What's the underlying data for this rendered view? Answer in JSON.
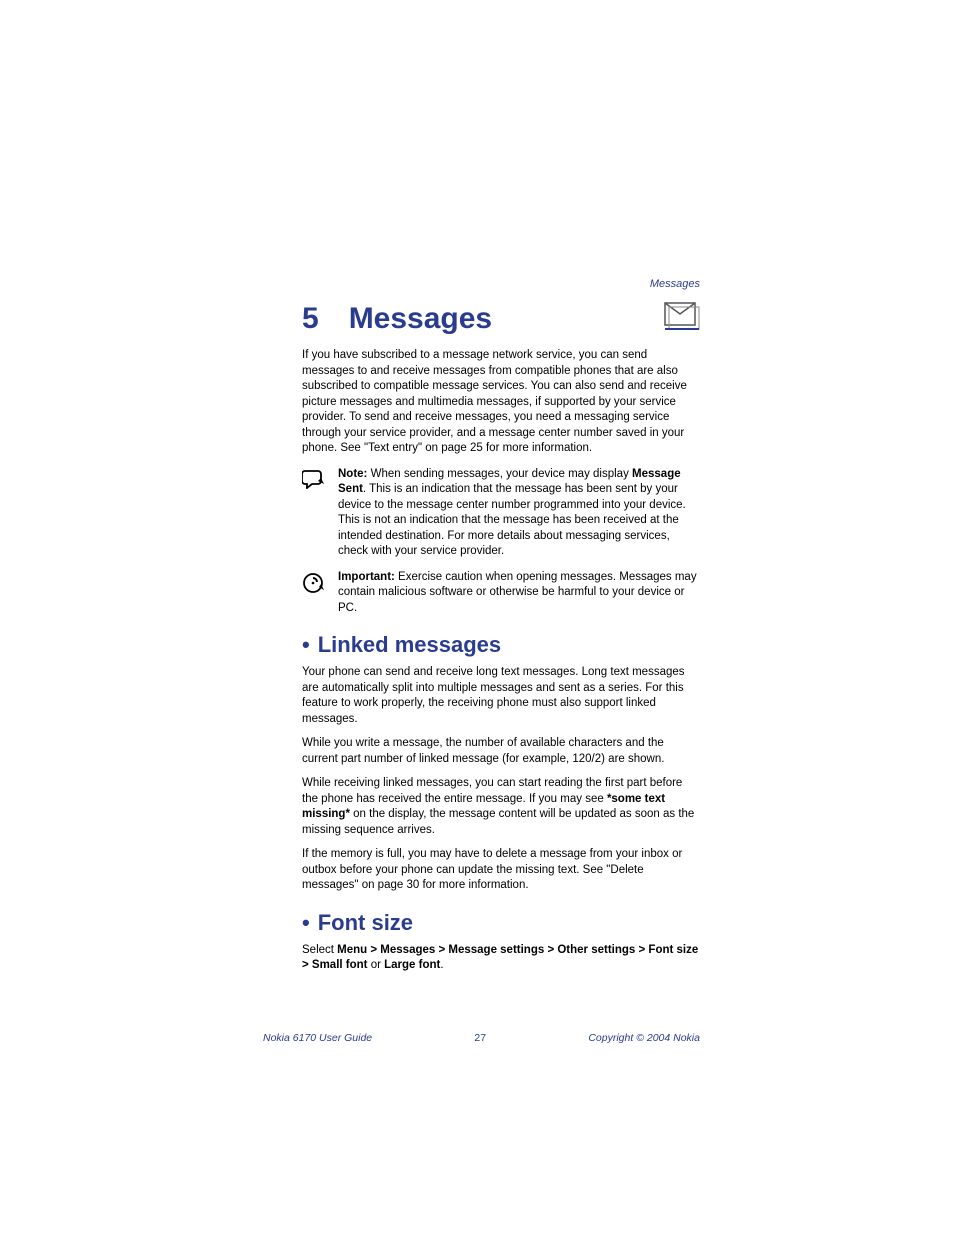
{
  "running_header": "Messages",
  "chapter": {
    "num": "5",
    "title": "Messages"
  },
  "intro": "If you have subscribed to a message network service, you can send messages to and receive messages from compatible phones that are also subscribed to compatible message services. You can also send and receive picture messages and multimedia messages, if supported by your service provider. To send and receive messages, you need a messaging service through your service provider, and a message center number saved in your phone. See \"Text entry\" on page 25 for more information.",
  "note": {
    "label": "Note:",
    "text_before_bold": " When sending messages, your device may display ",
    "bold": "Message Sent",
    "text_after_bold": ". This is an indication that the message has been sent by your device to the message center number programmed into your device. This is not an indication that the message has been received at the intended destination. For more details about messaging services, check with your service provider."
  },
  "important": {
    "label": "Important:",
    "text": " Exercise caution when opening messages.  Messages may contain malicious software or otherwise be harmful to your device or PC."
  },
  "sec1": {
    "title": "Linked messages",
    "p1": "Your phone can send and receive long text messages. Long text messages are automatically split into multiple messages and sent as a series. For this feature to work properly, the receiving phone must also support linked messages.",
    "p2": "While you write a message, the number of available characters and the current part number of linked message (for example, 120/2) are shown.",
    "p3_a": "While receiving linked messages, you can start reading the first part before the phone has received the entire message. If you may see ",
    "p3_bold": "*some text missing*",
    "p3_b": " on the display, the message content will be updated as soon as the missing sequence arrives.",
    "p4": "If the memory is full, you may have to delete a message from your inbox or outbox before your phone can update the missing text. See \"Delete messages\" on page 30 for more information."
  },
  "sec2": {
    "title": "Font size",
    "select_word": "Select ",
    "path": "Menu > Messages > Message settings > Other settings > Font size > Small font",
    "or": " or ",
    "lf": "Large font",
    "period": "."
  },
  "footer": {
    "left": "Nokia 6170 User Guide",
    "center": "27",
    "right": "Copyright © 2004 Nokia"
  }
}
